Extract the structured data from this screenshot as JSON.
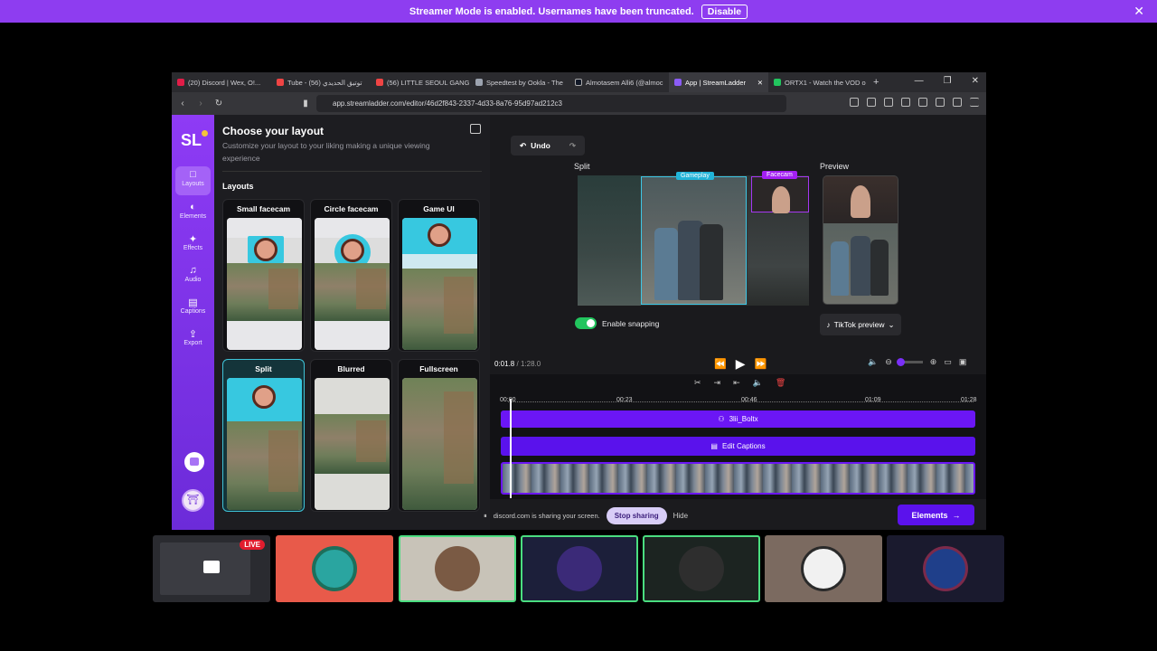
{
  "banner": {
    "message": "Streamer Mode is enabled. Usernames have been truncated.",
    "disable_label": "Disable",
    "close_label": "✕"
  },
  "browser": {
    "tabs": [
      {
        "label": "(20) Discord | Wex, O!...",
        "color": "#e11d48"
      },
      {
        "label": "Tube - توتيق الحديدي (56)",
        "color": "#ef4444"
      },
      {
        "label": "(56) LITTLE SEOUL GANG",
        "color": "#ef4444"
      },
      {
        "label": "Speedtest by Ookla - The",
        "color": "#9ca3af"
      },
      {
        "label": "Almotasem Alli6 (@almoc",
        "color": "#111827"
      },
      {
        "label": "App | StreamLadder",
        "color": "#8b5cf6"
      },
      {
        "label": "ORTX1 - Watch the VOD o",
        "color": "#22c55e"
      }
    ],
    "new_tab": "+",
    "url": "app.streamladder.com/editor/46d2f843-2337-4d33-8a76-95d97ad212c3",
    "window_controls": [
      "—",
      "❐",
      "✕"
    ]
  },
  "rail": {
    "logo": "SL",
    "items": [
      {
        "label": "Layouts",
        "icon": "□"
      },
      {
        "label": "Elements",
        "icon": "◐"
      },
      {
        "label": "Effects",
        "icon": "✦"
      },
      {
        "label": "Audio",
        "icon": "♫"
      },
      {
        "label": "Captions",
        "icon": "▤"
      },
      {
        "label": "Export",
        "icon": "⇪"
      }
    ],
    "avatar_glyph": "⛩"
  },
  "layout_panel": {
    "title": "Choose your layout",
    "description": "Customize your layout to your liking making a unique viewing experience",
    "section": "Layouts",
    "cards": [
      {
        "label": "Small facecam"
      },
      {
        "label": "Circle facecam"
      },
      {
        "label": "Game UI"
      },
      {
        "label": "Split"
      },
      {
        "label": "Blurred"
      },
      {
        "label": "Fullscreen"
      }
    ]
  },
  "editor": {
    "undo_label": "Undo",
    "split_label": "Split",
    "preview_label": "Preview",
    "gameplay_tag": "Gameplay",
    "facecam_tag": "Facecam",
    "snapping_label": "Enable snapping",
    "tiktok_label": "TikTok preview",
    "time_current": "0:01.8",
    "time_separator": "/",
    "time_total": "1:28.0",
    "ruler": [
      "00:00",
      "00:23",
      "00:46",
      "01:09",
      "01:28"
    ],
    "audio_track": "3lii_Boltx",
    "caption_track": "Edit Captions",
    "elements_button": "Elements"
  },
  "share_bar": {
    "message": "discord.com is sharing your screen.",
    "stop_label": "Stop sharing",
    "hide_label": "Hide"
  },
  "participants": {
    "live_badge": "LIVE"
  }
}
